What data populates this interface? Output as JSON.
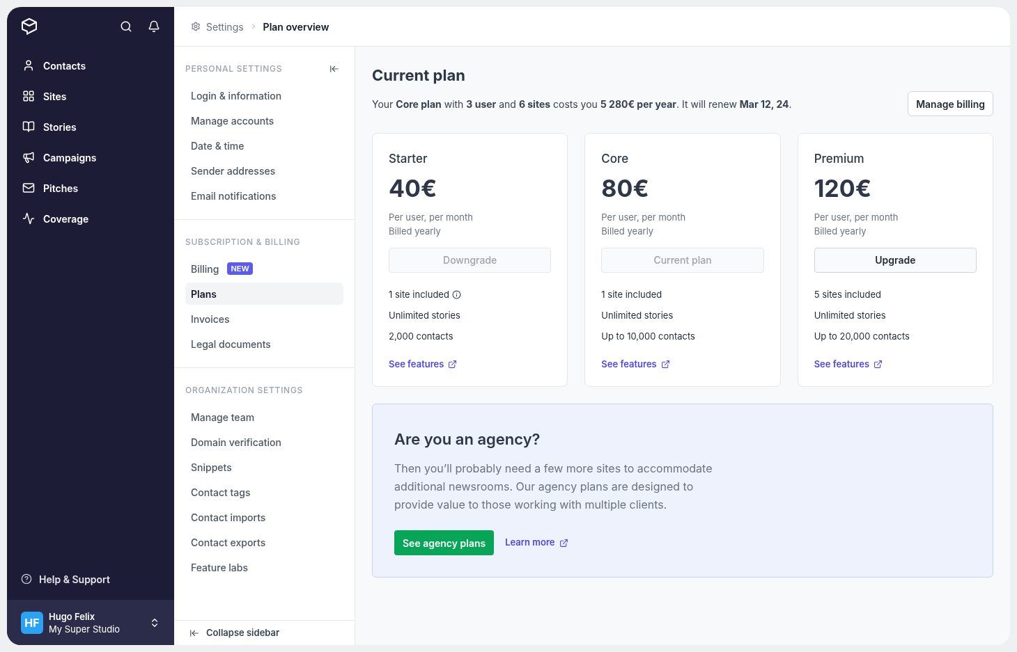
{
  "nav": {
    "items": [
      {
        "label": "Contacts"
      },
      {
        "label": "Sites"
      },
      {
        "label": "Stories"
      },
      {
        "label": "Campaigns"
      },
      {
        "label": "Pitches"
      },
      {
        "label": "Coverage"
      }
    ],
    "help": "Help & Support",
    "user": {
      "initials": "HF",
      "name": "Hugo Felix",
      "workspace": "My Super Studio"
    }
  },
  "breadcrumb": [
    "Settings",
    "Plan overview"
  ],
  "settings": {
    "groups": [
      {
        "title": "PERSONAL SETTINGS",
        "items": [
          {
            "label": "Login & information",
            "selected": false
          },
          {
            "label": "Manage accounts",
            "selected": false
          },
          {
            "label": "Date & time",
            "selected": false
          },
          {
            "label": "Sender addresses",
            "selected": false
          },
          {
            "label": "Email notifications",
            "selected": false
          }
        ]
      },
      {
        "title": "SUBSCRIPTION & BILLING",
        "items": [
          {
            "label": "Billing",
            "selected": false,
            "badge": "NEW"
          },
          {
            "label": "Plans",
            "selected": true
          },
          {
            "label": "Invoices",
            "selected": false
          },
          {
            "label": "Legal documents",
            "selected": false
          }
        ]
      },
      {
        "title": "ORGANIZATION SETTINGS",
        "items": [
          {
            "label": "Manage team",
            "selected": false
          },
          {
            "label": "Domain verification",
            "selected": false
          },
          {
            "label": "Snippets",
            "selected": false
          },
          {
            "label": "Contact tags",
            "selected": false
          },
          {
            "label": "Contact imports",
            "selected": false
          },
          {
            "label": "Contact exports",
            "selected": false
          },
          {
            "label": "Feature labs",
            "selected": false
          }
        ]
      }
    ],
    "collapse": "Collapse sidebar"
  },
  "main": {
    "title": "Current plan",
    "summary": "Your **Core plan** with **3 user** and **6 sites** costs you **5 280€ per year**. It will renew **Mar 12, 24**.",
    "manage_button": "Manage billing",
    "plans": [
      {
        "name": "Starter",
        "price": "40€",
        "period": "Per user, per month",
        "billing": "Billed yearly",
        "button": "Downgrade",
        "disabled": true,
        "features": [
          {
            "text": "1 site included",
            "info": true
          },
          {
            "text": "Unlimited stories",
            "info": false
          },
          {
            "text": "2,000 contacts",
            "info": false
          }
        ],
        "link": "See features"
      },
      {
        "name": "Core",
        "price": "80€",
        "period": "Per user, per month",
        "billing": "Billed yearly",
        "button": "Current plan",
        "disabled": true,
        "features": [
          {
            "text": "1 site included",
            "info": false
          },
          {
            "text": "Unlimited stories",
            "info": false
          },
          {
            "text": "Up to 10,000 contacts",
            "info": false
          }
        ],
        "link": "See features"
      },
      {
        "name": "Premium",
        "price": "120€",
        "period": "Per user, per month",
        "billing": "Billed yearly",
        "button": "Upgrade",
        "disabled": false,
        "features": [
          {
            "text": "5 sites included",
            "info": false
          },
          {
            "text": "Unlimited stories",
            "info": false
          },
          {
            "text": "Up to 20,000 contacts",
            "info": false
          }
        ],
        "link": "See features"
      }
    ],
    "agency": {
      "title": "Are you an agency?",
      "text": "Then you’ll probably need a few more sites to accommodate additional newsrooms. Our agency plans are designed to provide value to those working with multiple clients.",
      "button": "See agency plans",
      "link": "Learn more"
    }
  }
}
